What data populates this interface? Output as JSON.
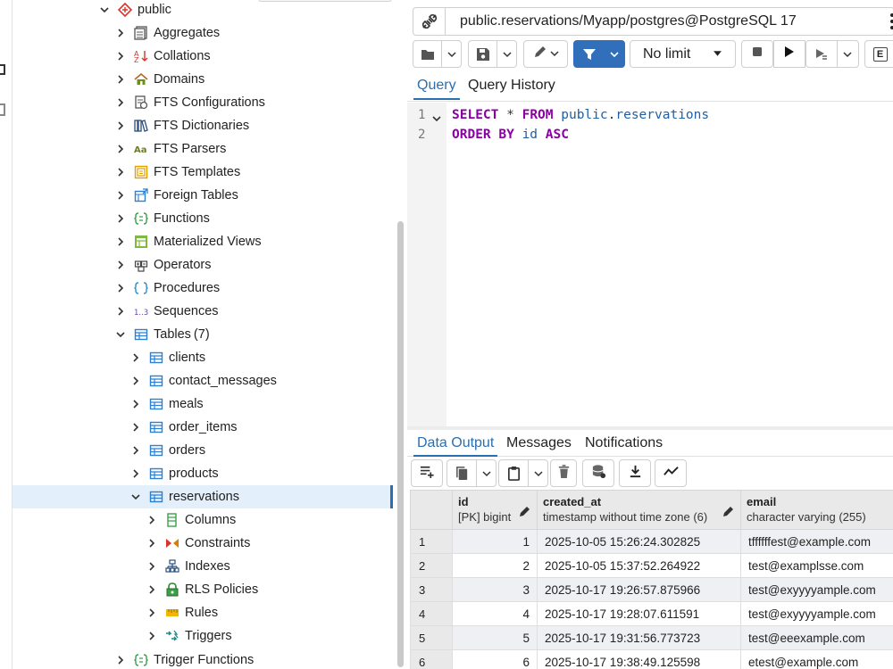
{
  "tree": {
    "schema_label": "public",
    "nodes": [
      {
        "label": "Aggregates",
        "icon": "aggregates-icon"
      },
      {
        "label": "Collations",
        "icon": "collations-icon"
      },
      {
        "label": "Domains",
        "icon": "domains-icon"
      },
      {
        "label": "FTS Configurations",
        "icon": "fts-configurations-icon"
      },
      {
        "label": "FTS Dictionaries",
        "icon": "fts-dictionaries-icon"
      },
      {
        "label": "FTS Parsers",
        "icon": "fts-parsers-icon"
      },
      {
        "label": "FTS Templates",
        "icon": "fts-templates-icon"
      },
      {
        "label": "Foreign Tables",
        "icon": "foreign-tables-icon"
      },
      {
        "label": "Functions",
        "icon": "functions-icon"
      },
      {
        "label": "Materialized Views",
        "icon": "materialized-views-icon"
      },
      {
        "label": "Operators",
        "icon": "operators-icon"
      },
      {
        "label": "Procedures",
        "icon": "procedures-icon"
      },
      {
        "label": "Sequences",
        "icon": "sequences-icon"
      }
    ],
    "tables_label": "Tables",
    "tables_count": "(7)",
    "tables": [
      "clients",
      "contact_messages",
      "meals",
      "order_items",
      "orders",
      "products",
      "reservations"
    ],
    "selected_table": "reservations",
    "table_children": [
      {
        "label": "Columns",
        "icon": "columns-icon"
      },
      {
        "label": "Constraints",
        "icon": "constraints-icon"
      },
      {
        "label": "Indexes",
        "icon": "indexes-icon"
      },
      {
        "label": "RLS Policies",
        "icon": "rls-policies-icon"
      },
      {
        "label": "Rules",
        "icon": "rules-icon"
      },
      {
        "label": "Triggers",
        "icon": "triggers-icon"
      }
    ],
    "trigger_functions_label": "Trigger Functions"
  },
  "connection": {
    "title": "public.reservations/Myapp/postgres@PostgreSQL 17"
  },
  "toolbar": {
    "limit_label": "No limit",
    "explain_label": "E"
  },
  "query_tabs": {
    "query": "Query",
    "history": "Query History"
  },
  "editor": {
    "line1": "1",
    "line2": "2",
    "select_kw": "SELECT",
    "star": " * ",
    "from_kw": "FROM",
    "schema_name": " public",
    "dot": ".",
    "table_name": "reservations",
    "order_kw": "ORDER BY",
    "order_col": " id ",
    "asc_kw": "ASC"
  },
  "result_tabs": {
    "data_output": "Data Output",
    "messages": "Messages",
    "notifications": "Notifications"
  },
  "grid": {
    "columns": [
      {
        "name": "id",
        "type": "[PK] bigint"
      },
      {
        "name": "created_at",
        "type": "timestamp without time zone (6)"
      },
      {
        "name": "email",
        "type": "character varying (255)"
      }
    ],
    "rows": [
      {
        "row": "1",
        "id": "1",
        "created_at": "2025-10-05 15:26:24.302825",
        "email": "tffffffest@example.com"
      },
      {
        "row": "2",
        "id": "2",
        "created_at": "2025-10-05 15:37:52.264922",
        "email": "test@examplsse.com"
      },
      {
        "row": "3",
        "id": "3",
        "created_at": "2025-10-17 19:26:57.875966",
        "email": "test@exyyyyample.com"
      },
      {
        "row": "4",
        "id": "4",
        "created_at": "2025-10-17 19:28:07.611591",
        "email": "test@exyyyyample.com"
      },
      {
        "row": "5",
        "id": "5",
        "created_at": "2025-10-17 19:31:56.773723",
        "email": "test@eeexample.com"
      },
      {
        "row": "6",
        "id": "6",
        "created_at": "2025-10-17 19:38:49.125598",
        "email": "etest@example.com"
      }
    ]
  },
  "colors": {
    "accent": "#2a6fb0",
    "filter_button": "#326fba",
    "keyword": "#8b00a5",
    "identifier": "#1f5fa8",
    "selection": "#e3f0fb"
  }
}
